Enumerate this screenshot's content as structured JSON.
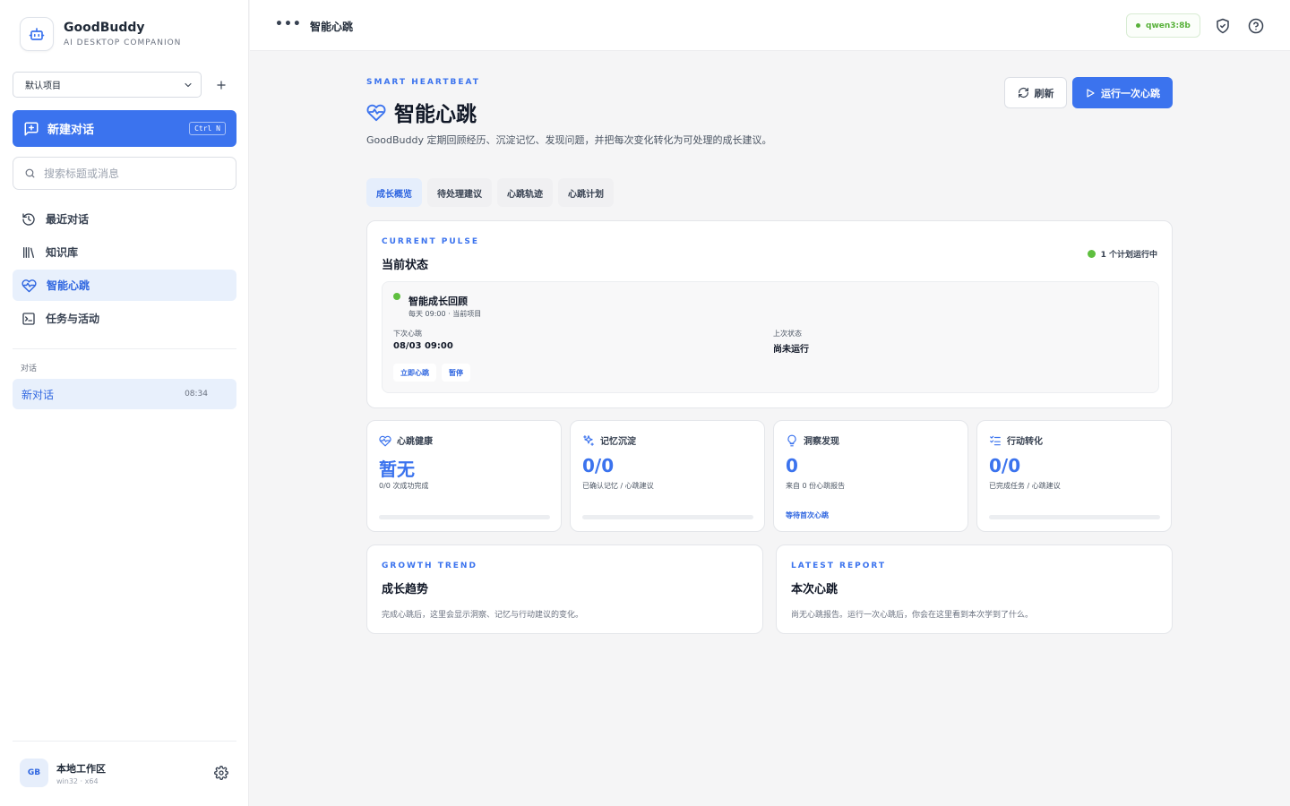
{
  "brand": {
    "name": "GoodBuddy",
    "subtitle": "AI DESKTOP COMPANION"
  },
  "sidebar": {
    "project_select": "默认项目",
    "new_chat": {
      "label": "新建对话",
      "shortcut": "Ctrl N"
    },
    "search_placeholder": "搜索标题或消息",
    "nav": [
      {
        "label": "最近对话",
        "icon": "history-icon",
        "active": false
      },
      {
        "label": "知识库",
        "icon": "library-icon",
        "active": false
      },
      {
        "label": "智能心跳",
        "icon": "heart-pulse-icon",
        "active": true
      },
      {
        "label": "任务与活动",
        "icon": "terminal-icon",
        "active": false
      }
    ],
    "section_label": "对话",
    "conversations": [
      {
        "title": "新对话",
        "time": "08:34"
      }
    ],
    "workspace": {
      "avatar": "GB",
      "name": "本地工作区",
      "platform": "win32 · x64"
    }
  },
  "topbar": {
    "title": "智能心跳",
    "model": "qwen3:8b"
  },
  "page": {
    "eyebrow": "SMART HEARTBEAT",
    "title": "智能心跳",
    "description": "GoodBuddy 定期回顾经历、沉淀记忆、发现问题，并把每次变化转化为可处理的成长建议。",
    "refresh_label": "刷新",
    "run_label": "运行一次心跳",
    "tabs": [
      "成长概览",
      "待处理建议",
      "心跳轨迹",
      "心跳计划"
    ],
    "active_tab": 0
  },
  "pulse": {
    "eyebrow": "CURRENT PULSE",
    "title": "当前状态",
    "plan_status": "1 个计划运行中",
    "plan": {
      "name": "智能成长回顾",
      "meta": "每天 09:00 · 当前项目",
      "next_label": "下次心跳",
      "next_value": "08/03 09:00",
      "last_label": "上次状态",
      "last_value": "尚未运行",
      "trigger_label": "立即心跳",
      "pause_label": "暂停"
    }
  },
  "stats": [
    {
      "label": "心跳健康",
      "icon": "heart-pulse-icon",
      "value": "暂无",
      "sub": "0/0 次成功完成",
      "progress": 0
    },
    {
      "label": "记忆沉淀",
      "icon": "sparkles-icon",
      "value": "0/0",
      "sub": "已确认记忆 / 心跳建议",
      "progress": 0
    },
    {
      "label": "洞察发现",
      "icon": "lightbulb-icon",
      "value": "0",
      "sub": "来自 0 份心跳报告",
      "link": "等待首次心跳"
    },
    {
      "label": "行动转化",
      "icon": "checklist-icon",
      "value": "0/0",
      "sub": "已完成任务 / 心跳建议",
      "progress": 0
    }
  ],
  "trend": {
    "eyebrow": "GROWTH TREND",
    "title": "成长趋势",
    "description": "完成心跳后，这里会显示洞察、记忆与行动建议的变化。"
  },
  "report": {
    "eyebrow": "LATEST REPORT",
    "title": "本次心跳",
    "description": "尚无心跳报告。运行一次心跳后，你会在这里看到本次学到了什么。"
  },
  "colors": {
    "accent": "#3b73ee",
    "active_bg": "#e8f0fc",
    "success": "#5fbf3f"
  }
}
